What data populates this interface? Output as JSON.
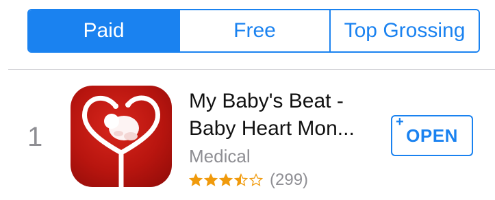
{
  "segmented_control": {
    "segments": [
      {
        "label": "Paid",
        "selected": true
      },
      {
        "label": "Free",
        "selected": false
      },
      {
        "label": "Top Grossing",
        "selected": false
      }
    ]
  },
  "app": {
    "rank": "1",
    "title_line1": "My Baby's Beat -",
    "title_line2": "Baby Heart Mon...",
    "category": "Medical",
    "rating": 3.5,
    "rating_max": 5,
    "rating_count": "(299)",
    "icon": "heart-stethoscope-baby-icon",
    "button_label": "OPEN",
    "button_plus": "+"
  },
  "colors": {
    "accent": "#1a82f0",
    "star": "#f09a0c",
    "icon_red": "#c2170f",
    "secondary_text": "#8e8e93"
  }
}
